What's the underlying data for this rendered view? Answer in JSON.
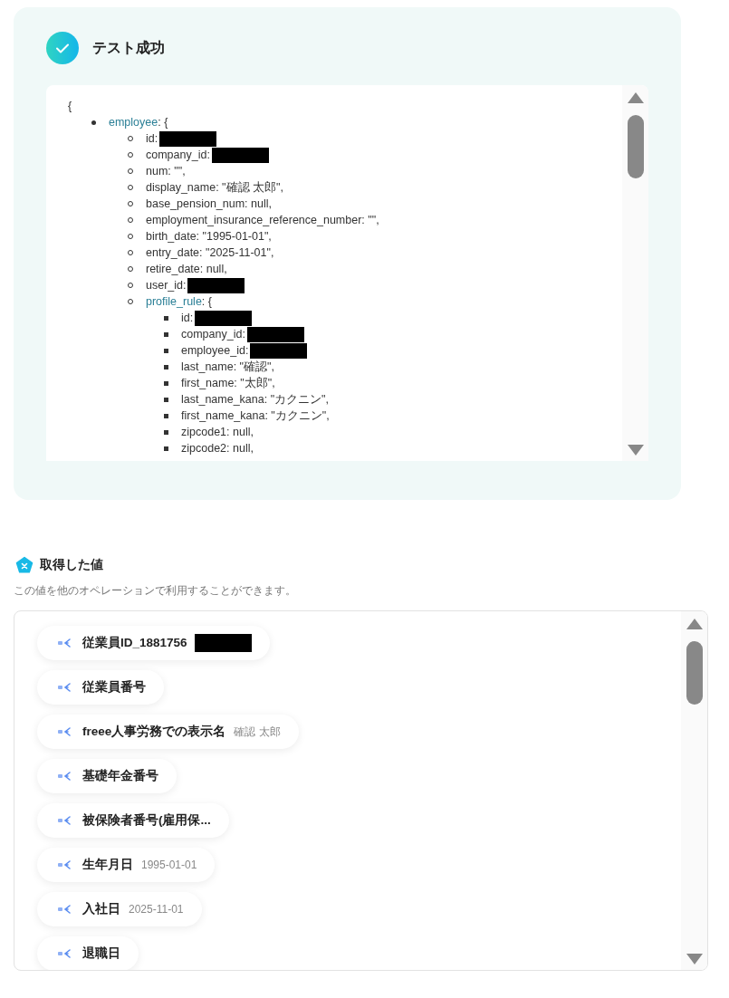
{
  "result": {
    "title": "テスト成功",
    "code": {
      "open": "{",
      "lines": [
        {
          "key": "employee",
          "text": ": {",
          "children": [
            {
              "text": "id:",
              "redacted": true
            },
            {
              "text": "company_id:",
              "redacted": true
            },
            {
              "text": "num: \"\","
            },
            {
              "text": "display_name: \"確認 太郎\","
            },
            {
              "text": "base_pension_num: null,"
            },
            {
              "text": "employment_insurance_reference_number: \"\","
            },
            {
              "text": "birth_date: \"1995-01-01\","
            },
            {
              "text": "entry_date: \"2025-11-01\","
            },
            {
              "text": "retire_date: null,"
            },
            {
              "text": "user_id:",
              "redacted": true
            },
            {
              "key": "profile_rule",
              "text": ": {",
              "children": [
                {
                  "text": "id:",
                  "redacted": true
                },
                {
                  "text": "company_id:",
                  "redacted": true
                },
                {
                  "text": "employee_id:",
                  "redacted": true
                },
                {
                  "text": "last_name: \"確認\","
                },
                {
                  "text": "first_name: \"太郎\","
                },
                {
                  "text": "last_name_kana: \"カクニン\","
                },
                {
                  "text": "first_name_kana: \"カクニン\","
                },
                {
                  "text": "zipcode1: null,"
                },
                {
                  "text": "zipcode2: null,"
                }
              ]
            }
          ]
        }
      ]
    }
  },
  "values": {
    "title": "取得した値",
    "subtitle": "この値を他のオペレーションで利用することができます。",
    "items": [
      {
        "label": "従業員ID_1881756",
        "redacted": true
      },
      {
        "label": "従業員番号"
      },
      {
        "label": "freee人事労務での表示名",
        "value": "確認 太郎"
      },
      {
        "label": "基礎年金番号"
      },
      {
        "label": "被保険者番号(雇用保..."
      },
      {
        "label": "生年月日",
        "value": "1995-01-01"
      },
      {
        "label": "入社日",
        "value": "2025-11-01"
      },
      {
        "label": "退職日"
      }
    ]
  }
}
